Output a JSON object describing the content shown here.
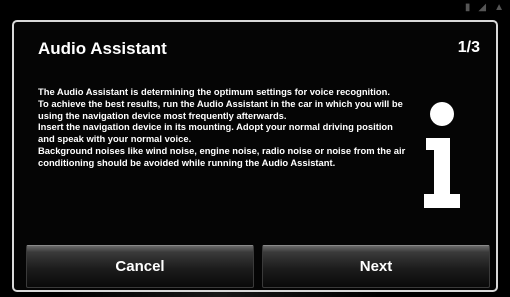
{
  "dialog": {
    "title": "Audio Assistant",
    "page_indicator": "1/3",
    "paragraphs": [
      "The Audio Assistant is determining the optimum settings for voice recognition.",
      "To achieve the best results, run the Audio Assistant in the car in which you will be using the navigation device most frequently afterwards.",
      "Insert the navigation device in its mounting. Adopt your normal driving position and speak with your normal voice.",
      "Background noises like wind noise, engine noise, radio noise or noise from the air conditioning should be avoided while running the Audio Assistant."
    ],
    "info_icon": "info-icon"
  },
  "buttons": {
    "cancel_label": "Cancel",
    "next_label": "Next"
  },
  "colors": {
    "background": "#000000",
    "dialog_border": "#d9d9d9",
    "text": "#ffffff"
  }
}
